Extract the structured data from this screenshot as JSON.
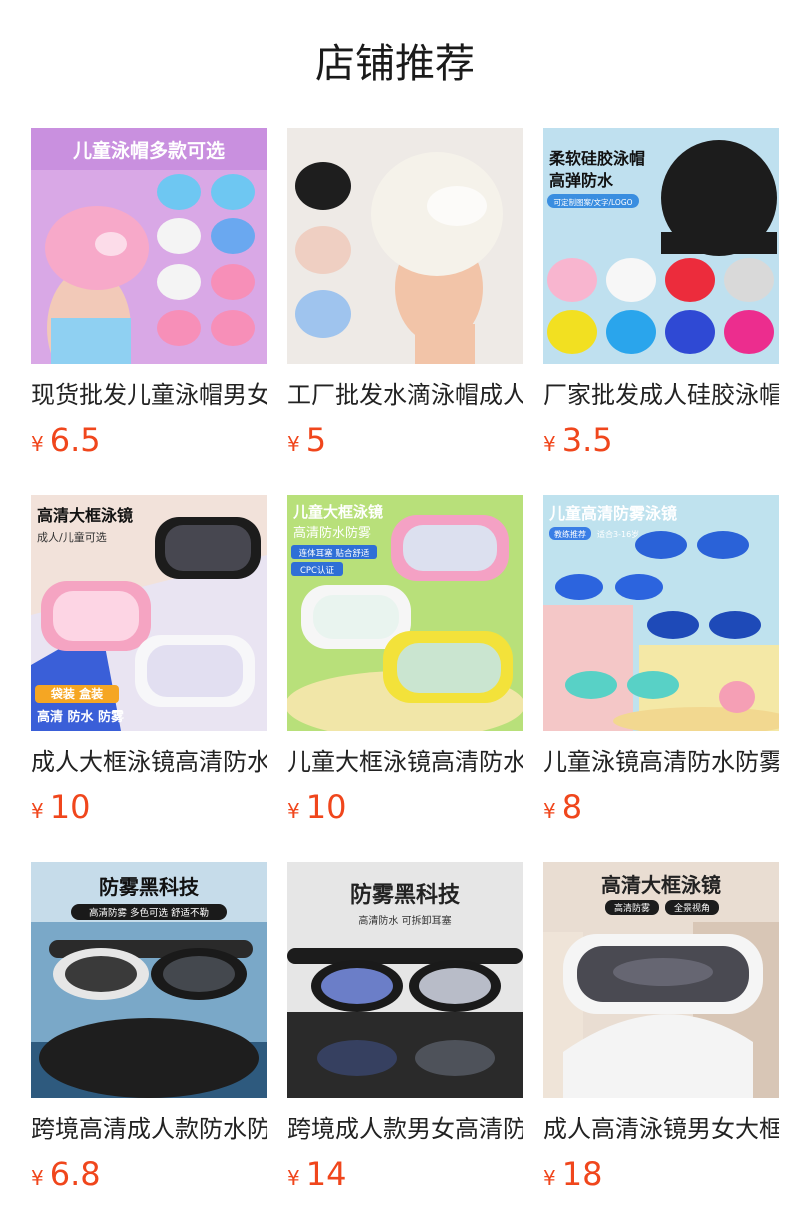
{
  "heading": "店铺推荐",
  "currency": "¥",
  "colors": {
    "price": "#f0461c",
    "text": "#222222"
  },
  "products": [
    {
      "name": "现货批发儿童泳帽男女",
      "price": "6.5",
      "banner": "儿童泳帽多款可选"
    },
    {
      "name": "工厂批发水滴泳帽成人",
      "price": "5"
    },
    {
      "name": "厂家批发成人硅胶泳帽",
      "price": "3.5",
      "banner": "柔软硅胶泳帽",
      "banner2": "高弹防水",
      "badge": "可定制图案/文字/LOGO"
    },
    {
      "name": "成人大框泳镜高清防水",
      "price": "10",
      "banner": "高清大框泳镜",
      "banner2": "成人/儿童可选",
      "badge": "袋装 盒装",
      "footer": "高清 防水 防雾"
    },
    {
      "name": "儿童大框泳镜高清防水",
      "price": "10",
      "banner": "儿童大框泳镜",
      "banner2": "高清防水防雾",
      "badge": "连体耳塞 贴合舒适",
      "badge2": "CPC认证"
    },
    {
      "name": "儿童泳镜高清防水防雾",
      "price": "8",
      "banner": "儿童高清防雾泳镜",
      "badge": "教练推荐",
      "badge2": "适合3-16岁"
    },
    {
      "name": "跨境高清成人款防水防雾",
      "price": "6.8",
      "banner": "防雾黑科技",
      "badge": "高清防雾 多色可选 舒适不勒"
    },
    {
      "name": "跨境成人款男女高清防水",
      "price": "14",
      "banner": "防雾黑科技",
      "badge": "高清防水 可拆卸耳塞"
    },
    {
      "name": "成人高清泳镜男女大框",
      "price": "18",
      "banner": "高清大框泳镜",
      "badge": "高清防雾",
      "badge2": "全景视角"
    }
  ]
}
